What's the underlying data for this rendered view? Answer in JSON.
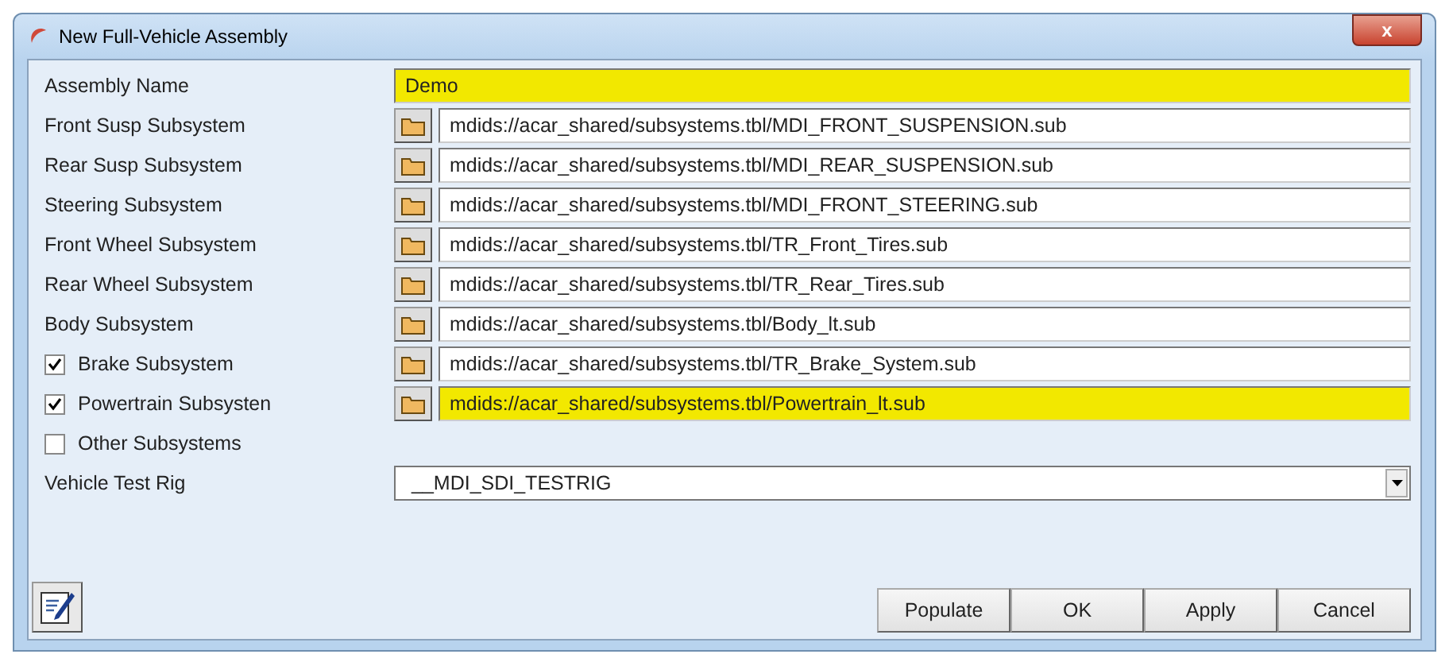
{
  "window": {
    "title": "New Full-Vehicle Assembly",
    "close": "x"
  },
  "rows": [
    {
      "kind": "text",
      "label": "Assembly Name",
      "value": "Demo",
      "highlighted": true
    },
    {
      "kind": "file",
      "label": "Front Susp Subsystem",
      "value": "mdids://acar_shared/subsystems.tbl/MDI_FRONT_SUSPENSION.sub",
      "highlighted": false
    },
    {
      "kind": "file",
      "label": "Rear Susp Subsystem",
      "value": "mdids://acar_shared/subsystems.tbl/MDI_REAR_SUSPENSION.sub",
      "highlighted": false
    },
    {
      "kind": "file",
      "label": "Steering Subsystem",
      "value": "mdids://acar_shared/subsystems.tbl/MDI_FRONT_STEERING.sub",
      "highlighted": false
    },
    {
      "kind": "file",
      "label": "Front Wheel Subsystem",
      "value": "mdids://acar_shared/subsystems.tbl/TR_Front_Tires.sub",
      "highlighted": false
    },
    {
      "kind": "file",
      "label": "Rear Wheel Subsystem",
      "value": "mdids://acar_shared/subsystems.tbl/TR_Rear_Tires.sub",
      "highlighted": false
    },
    {
      "kind": "file",
      "label": "Body Subsystem",
      "value": "mdids://acar_shared/subsystems.tbl/Body_lt.sub",
      "highlighted": false
    },
    {
      "kind": "file",
      "label": "Brake Subsystem",
      "checked": true,
      "value": "mdids://acar_shared/subsystems.tbl/TR_Brake_System.sub",
      "highlighted": false
    },
    {
      "kind": "file",
      "label": "Powertrain Subsysten",
      "checked": true,
      "value": "mdids://acar_shared/subsystems.tbl/Powertrain_lt.sub",
      "highlighted": true
    },
    {
      "kind": "option",
      "label": "Other Subsystems",
      "checked": false
    },
    {
      "kind": "dropdown",
      "label": "Vehicle Test Rig",
      "value": "__MDI_SDI_TESTRIG"
    }
  ],
  "buttons": [
    "Populate",
    "OK",
    "Apply",
    "Cancel"
  ]
}
